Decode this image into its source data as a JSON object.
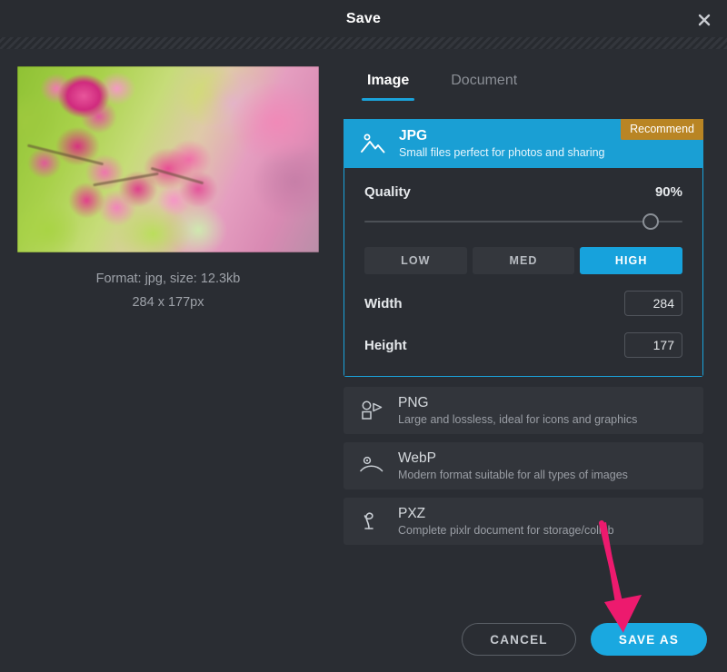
{
  "dialog": {
    "title": "Save",
    "close_icon": "close-icon"
  },
  "preview": {
    "format_line": "Format: jpg, size: 12.3kb",
    "dimension_line": "284 x 177px",
    "image_alt": "pink coral vine flowers on green bokeh background"
  },
  "tabs": [
    {
      "label": "Image",
      "active": true
    },
    {
      "label": "Document",
      "active": false
    }
  ],
  "formats": [
    {
      "name": "JPG",
      "description": "Small files perfect for photos and sharing",
      "badge": "Recommend",
      "icon": "photo-mountain-icon",
      "selected": true
    },
    {
      "name": "PNG",
      "description": "Large and lossless, ideal for icons and graphics",
      "icon": "shapes-icon",
      "selected": false
    },
    {
      "name": "WebP",
      "description": "Modern format suitable for all types of images",
      "icon": "smile-curve-icon",
      "selected": false
    },
    {
      "name": "PXZ",
      "description": "Complete pixlr document for storage/collab",
      "icon": "pixlr-loop-icon",
      "selected": false
    }
  ],
  "jpg_settings": {
    "quality_label": "Quality",
    "quality_value": "90%",
    "quality_percent": 90,
    "presets": [
      {
        "label": "LOW",
        "active": false
      },
      {
        "label": "MED",
        "active": false
      },
      {
        "label": "HIGH",
        "active": true
      }
    ],
    "width_label": "Width",
    "width_value": "284",
    "height_label": "Height",
    "height_value": "177"
  },
  "footer": {
    "cancel_label": "CANCEL",
    "save_label": "SAVE AS"
  },
  "colors": {
    "accent_blue": "#1aa3db",
    "badge_gold": "#b98524",
    "arrow_pink": "#ed1a6e",
    "panel_bg": "#2a2d33",
    "card_bg": "#32353b"
  }
}
